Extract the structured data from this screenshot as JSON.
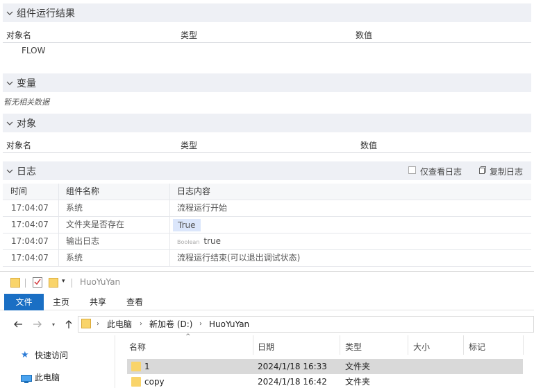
{
  "sections": {
    "results": {
      "title": "组件运行结果",
      "cols": [
        "对象名",
        "类型",
        "数值"
      ],
      "rows": [
        {
          "name": "FLOW"
        }
      ]
    },
    "variables": {
      "title": "变量",
      "empty": "暂无相关数据"
    },
    "objects": {
      "title": "对象",
      "cols": [
        "对象名",
        "类型",
        "数值"
      ]
    },
    "log": {
      "title": "日志",
      "only_log_label": "仅查看日志",
      "copy_label": "复制日志",
      "cols": [
        "时间",
        "组件名称",
        "日志内容"
      ],
      "rows": [
        {
          "time": "17:04:07",
          "component": "系统",
          "content": "流程运行开始"
        },
        {
          "time": "17:04:07",
          "component": "文件夹是否存在",
          "content": "True"
        },
        {
          "time": "17:04:07",
          "component": "输出日志",
          "tag": "Boolean",
          "content": "true"
        },
        {
          "time": "17:04:07",
          "component": "系统",
          "content": "流程运行结束(可以退出调试状态)"
        }
      ]
    }
  },
  "explorer": {
    "title": "HuoYuYan",
    "ribbon": [
      "文件",
      "主页",
      "共享",
      "查看"
    ],
    "breadcrumb": [
      "此电脑",
      "新加卷 (D:)",
      "HuoYuYan"
    ],
    "nav": [
      {
        "label": "快速访问",
        "icon": "star-icon"
      },
      {
        "label": "此电脑",
        "icon": "monitor-icon"
      }
    ],
    "columns": [
      "名称",
      "日期",
      "类型",
      "大小",
      "标记"
    ],
    "files": [
      {
        "name": "1",
        "date": "2024/1/18 16:33",
        "type": "文件夹"
      },
      {
        "name": "copy",
        "date": "2024/1/18 16:42",
        "type": "文件夹"
      }
    ]
  },
  "colors": {
    "accent": "#1a6fc4",
    "section_bg": "#eef0f5",
    "folder": "#f9d46a",
    "selection": "#d9d9d9"
  }
}
